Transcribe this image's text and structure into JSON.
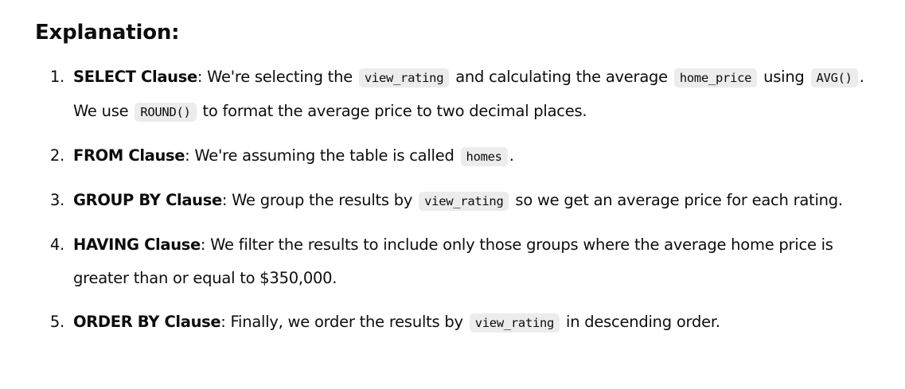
{
  "heading": "Explanation:",
  "items": [
    {
      "number": "1.",
      "term": "SELECT Clause",
      "t1": ": We're selecting the ",
      "c1": "view_rating",
      "t2": " and calculating the average ",
      "c2": "home_price",
      "t3": " using ",
      "c3": "AVG()",
      "t4": ". We use ",
      "c4": "ROUND()",
      "t5": " to format the average price to two decimal places."
    },
    {
      "number": "2.",
      "term": "FROM Clause",
      "t1": ": We're assuming the table is called ",
      "c1": "homes",
      "t2": "."
    },
    {
      "number": "3.",
      "term": "GROUP BY Clause",
      "t1": ": We group the results by ",
      "c1": "view_rating",
      "t2": " so we get an average price for each rating."
    },
    {
      "number": "4.",
      "term": "HAVING Clause",
      "t1": ": We filter the results to include only those groups where the average home price is greater than or equal to $350,000."
    },
    {
      "number": "5.",
      "term": "ORDER BY Clause",
      "t1": ": Finally, we order the results by ",
      "c1": "view_rating",
      "t2": " in descending order."
    }
  ]
}
